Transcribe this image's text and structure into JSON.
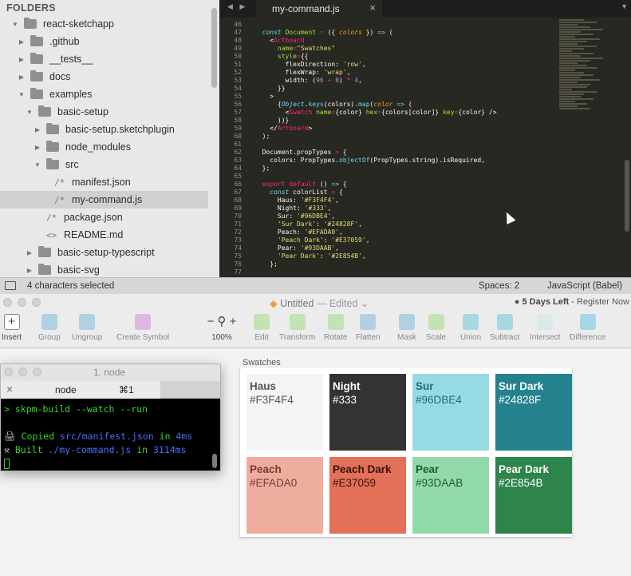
{
  "sidebar": {
    "title": "FOLDERS",
    "items": [
      {
        "label": "react-sketchapp",
        "type": "folder",
        "expanded": true,
        "depth": 0
      },
      {
        "label": ".github",
        "type": "folder",
        "expanded": false,
        "depth": 1
      },
      {
        "label": "__tests__",
        "type": "folder",
        "expanded": false,
        "depth": 1
      },
      {
        "label": "docs",
        "type": "folder",
        "expanded": false,
        "depth": 1
      },
      {
        "label": "examples",
        "type": "folder",
        "expanded": true,
        "depth": 1
      },
      {
        "label": "basic-setup",
        "type": "folder",
        "expanded": true,
        "depth": 2
      },
      {
        "label": "basic-setup.sketchplugin",
        "type": "folder",
        "expanded": false,
        "depth": 3
      },
      {
        "label": "node_modules",
        "type": "folder",
        "expanded": false,
        "depth": 3
      },
      {
        "label": "src",
        "type": "folder",
        "expanded": true,
        "depth": 3
      },
      {
        "label": "manifest.json",
        "type": "file",
        "icon": "/*",
        "depth": 4
      },
      {
        "label": "my-command.js",
        "type": "file",
        "icon": "/*",
        "depth": 4,
        "selected": true
      },
      {
        "label": "package.json",
        "type": "file",
        "icon": "/*",
        "depth": 3
      },
      {
        "label": "README.md",
        "type": "file",
        "icon": "<>",
        "depth": 3
      },
      {
        "label": "basic-setup-typescript",
        "type": "folder",
        "expanded": false,
        "depth": 2
      },
      {
        "label": "basic-svg",
        "type": "folder",
        "expanded": false,
        "depth": 2
      }
    ]
  },
  "editor": {
    "tab_label": "my-command.js",
    "tab_close": "×",
    "line_numbers": [
      "46",
      "47",
      "48",
      "49",
      "50",
      "51",
      "52",
      "53",
      "54",
      "55",
      "56",
      "57",
      "58",
      "59",
      "60",
      "61",
      "62",
      "63",
      "64",
      "65",
      "66",
      "67",
      "68",
      "69",
      "70",
      "71",
      "72",
      "73",
      "74",
      "75",
      "76",
      "77"
    ]
  },
  "statusbar": {
    "selection": "4 characters selected",
    "spaces": "Spaces: 2",
    "syntax": "JavaScript (Babel)"
  },
  "sketch": {
    "title_untitled": "Untitled",
    "title_edited": " — Edited ⌄",
    "trial_days": "5 Days Left",
    "trial_action": " - Register Now",
    "toolbar": [
      {
        "label": "Insert",
        "icon": "plus-icon"
      },
      {
        "label": "Group",
        "icon": "group-icon"
      },
      {
        "label": "Ungroup",
        "icon": "ungroup-icon"
      },
      {
        "label": "Create Symbol",
        "icon": "symbol-icon"
      },
      {
        "label": "100%",
        "icon": "zoom-icon"
      },
      {
        "label": "Edit",
        "icon": "edit-icon"
      },
      {
        "label": "Transform",
        "icon": "transform-icon"
      },
      {
        "label": "Rotate",
        "icon": "rotate-icon"
      },
      {
        "label": "Flatten",
        "icon": "flatten-icon"
      },
      {
        "label": "Mask",
        "icon": "mask-icon"
      },
      {
        "label": "Scale",
        "icon": "scale-icon"
      },
      {
        "label": "Union",
        "icon": "union-icon"
      },
      {
        "label": "Subtract",
        "icon": "subtract-icon"
      },
      {
        "label": "Intersect",
        "icon": "intersect-icon"
      },
      {
        "label": "Difference",
        "icon": "difference-icon"
      }
    ],
    "artboard_name": "Swatches",
    "swatches": [
      {
        "name": "Haus",
        "hex": "#F3F4F4",
        "text": "#555555"
      },
      {
        "name": "Night",
        "hex": "#333",
        "text": "#ffffff"
      },
      {
        "name": "Sur",
        "hex": "#96DBE4",
        "text": "#1f6d7a"
      },
      {
        "name": "Sur Dark",
        "hex": "#24828F",
        "text": "#ffffff"
      },
      {
        "name": "Peach",
        "hex": "#EFADA0",
        "text": "#7a3a2e"
      },
      {
        "name": "Peach Dark",
        "hex": "#E37059",
        "text": "#3a1208"
      },
      {
        "name": "Pear",
        "hex": "#93DAAB",
        "text": "#1e5a33"
      },
      {
        "name": "Pear Dark",
        "hex": "#2E854B",
        "text": "#ffffff"
      }
    ]
  },
  "terminal": {
    "title": "1. node",
    "tab_name": "node",
    "tab_shortcut": "⌘1",
    "command_prompt": "> ",
    "command": "skpm-build --watch --run",
    "line1_prefix": "Copied ",
    "line1_path": "src/manifest.json",
    "line1_mid": " in ",
    "line1_time": "4ms",
    "line2_prefix": "Built ",
    "line2_path": "./my-command.js",
    "line2_mid": " in ",
    "line2_time": "3114ms"
  }
}
